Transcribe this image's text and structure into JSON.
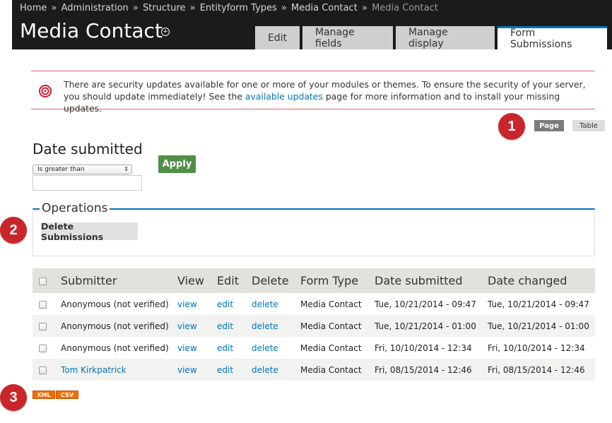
{
  "breadcrumb": {
    "items": [
      "Home",
      "Administration",
      "Structure",
      "Entityform Types",
      "Media Contact"
    ],
    "current": "Media Contact",
    "separator": "»"
  },
  "header": {
    "title": "Media Contact",
    "shortcut_icon": "plus-circle-icon"
  },
  "tabs": [
    {
      "label": "Edit",
      "active": false
    },
    {
      "label": "Manage fields",
      "active": false
    },
    {
      "label": "Manage display",
      "active": false
    },
    {
      "label": "Form Submissions",
      "active": true
    }
  ],
  "message": {
    "icon": "warning-icon",
    "text_before": "There are security updates available for one or more of your modules or themes. To ensure the security of your server, you should update immediately! See the ",
    "link": "available updates",
    "text_after": " page for more information and to install your missing updates."
  },
  "annotations": [
    "1",
    "2",
    "3"
  ],
  "view_switch": {
    "page_label": "Page",
    "table_label": "Table"
  },
  "filter": {
    "label": "Date submitted",
    "operator": "Is greater than",
    "value": "",
    "apply_label": "Apply"
  },
  "operations": {
    "legend": "Operations",
    "delete_label": "Delete Submissions"
  },
  "table": {
    "headers": [
      "Submitter",
      "View",
      "Edit",
      "Delete",
      "Form Type",
      "Date submitted",
      "Date changed"
    ],
    "rows": [
      {
        "submitter": "Anonymous (not verified)",
        "submitter_link": false,
        "view": "view",
        "edit": "edit",
        "delete": "delete",
        "form_type": "Media Contact",
        "submitted": "Tue, 10/21/2014 - 09:47",
        "changed": "Tue, 10/21/2014 - 09:47"
      },
      {
        "submitter": "Anonymous (not verified)",
        "submitter_link": false,
        "view": "view",
        "edit": "edit",
        "delete": "delete",
        "form_type": "Media Contact",
        "submitted": "Tue, 10/21/2014 - 01:00",
        "changed": "Tue, 10/21/2014 - 01:00"
      },
      {
        "submitter": "Anonymous (not verified)",
        "submitter_link": false,
        "view": "view",
        "edit": "edit",
        "delete": "delete",
        "form_type": "Media Contact",
        "submitted": "Fri, 10/10/2014 - 12:34",
        "changed": "Fri, 10/10/2014 - 12:34"
      },
      {
        "submitter": "Tom Kirkpatrick",
        "submitter_link": true,
        "view": "view",
        "edit": "edit",
        "delete": "delete",
        "form_type": "Media Contact",
        "submitted": "Fri, 08/15/2014 - 12:46",
        "changed": "Fri, 08/15/2014 - 12:46"
      }
    ]
  },
  "feeds": {
    "xml": "XML",
    "csv": "CSV"
  },
  "colors": {
    "header_bg": "#1b1b1b",
    "accent": "#0074bd",
    "apply": "#4f8f47",
    "badge": "#c8262b",
    "feed": "#f26d00"
  }
}
